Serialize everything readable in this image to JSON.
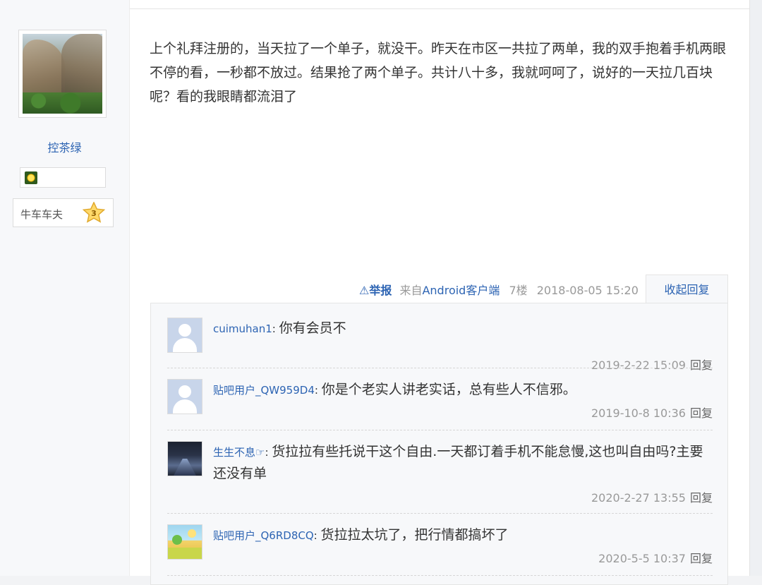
{
  "author": {
    "username": "控茶绿",
    "level_title": "牛车车夫",
    "level": "3"
  },
  "post": {
    "content": "上个礼拜注册的，当天拉了一个单子，就没干。昨天在市区一共拉了两单，我的双手抱着手机两眼不停的看，一秒都不放过。结果抢了两个单子。共计八十多，我就呵呵了，说好的一天拉几百块呢？看的我眼睛都流泪了",
    "report_label": "举报",
    "source_prefix": "来自",
    "source_client": "Android客户端",
    "floor": "7楼",
    "datetime": "2018-08-05 15:20",
    "collapse_label": "收起回复"
  },
  "replies": [
    {
      "user": "cuimuhan1",
      "text": "你有会员不",
      "time": "2019-2-22 15:09",
      "reply_label": "回复",
      "avatar": "default-avatar-icon"
    },
    {
      "user": "贴吧用户_QW959D4",
      "text": "你是个老实人讲老实话，总有些人不信邪。",
      "time": "2019-10-8 10:36",
      "reply_label": "回复",
      "avatar": "default-avatar-icon"
    },
    {
      "user": "生生不息☞",
      "text": "货拉拉有些托说干这个自由.一天都订着手机不能怠慢,这也叫自由吗?主要还没有单",
      "time": "2020-2-27 13:55",
      "reply_label": "回复",
      "avatar": "road-night-avatar"
    },
    {
      "user": "贴吧用户_Q6RD8CQ",
      "text": "货拉拉太坑了，把行情都搞坏了",
      "time": "2020-5-5 10:37",
      "reply_label": "回复",
      "avatar": "cartoon-landscape-avatar"
    }
  ],
  "colors": {
    "link": "#2d64b3",
    "meta": "#999999",
    "text": "#333333"
  }
}
